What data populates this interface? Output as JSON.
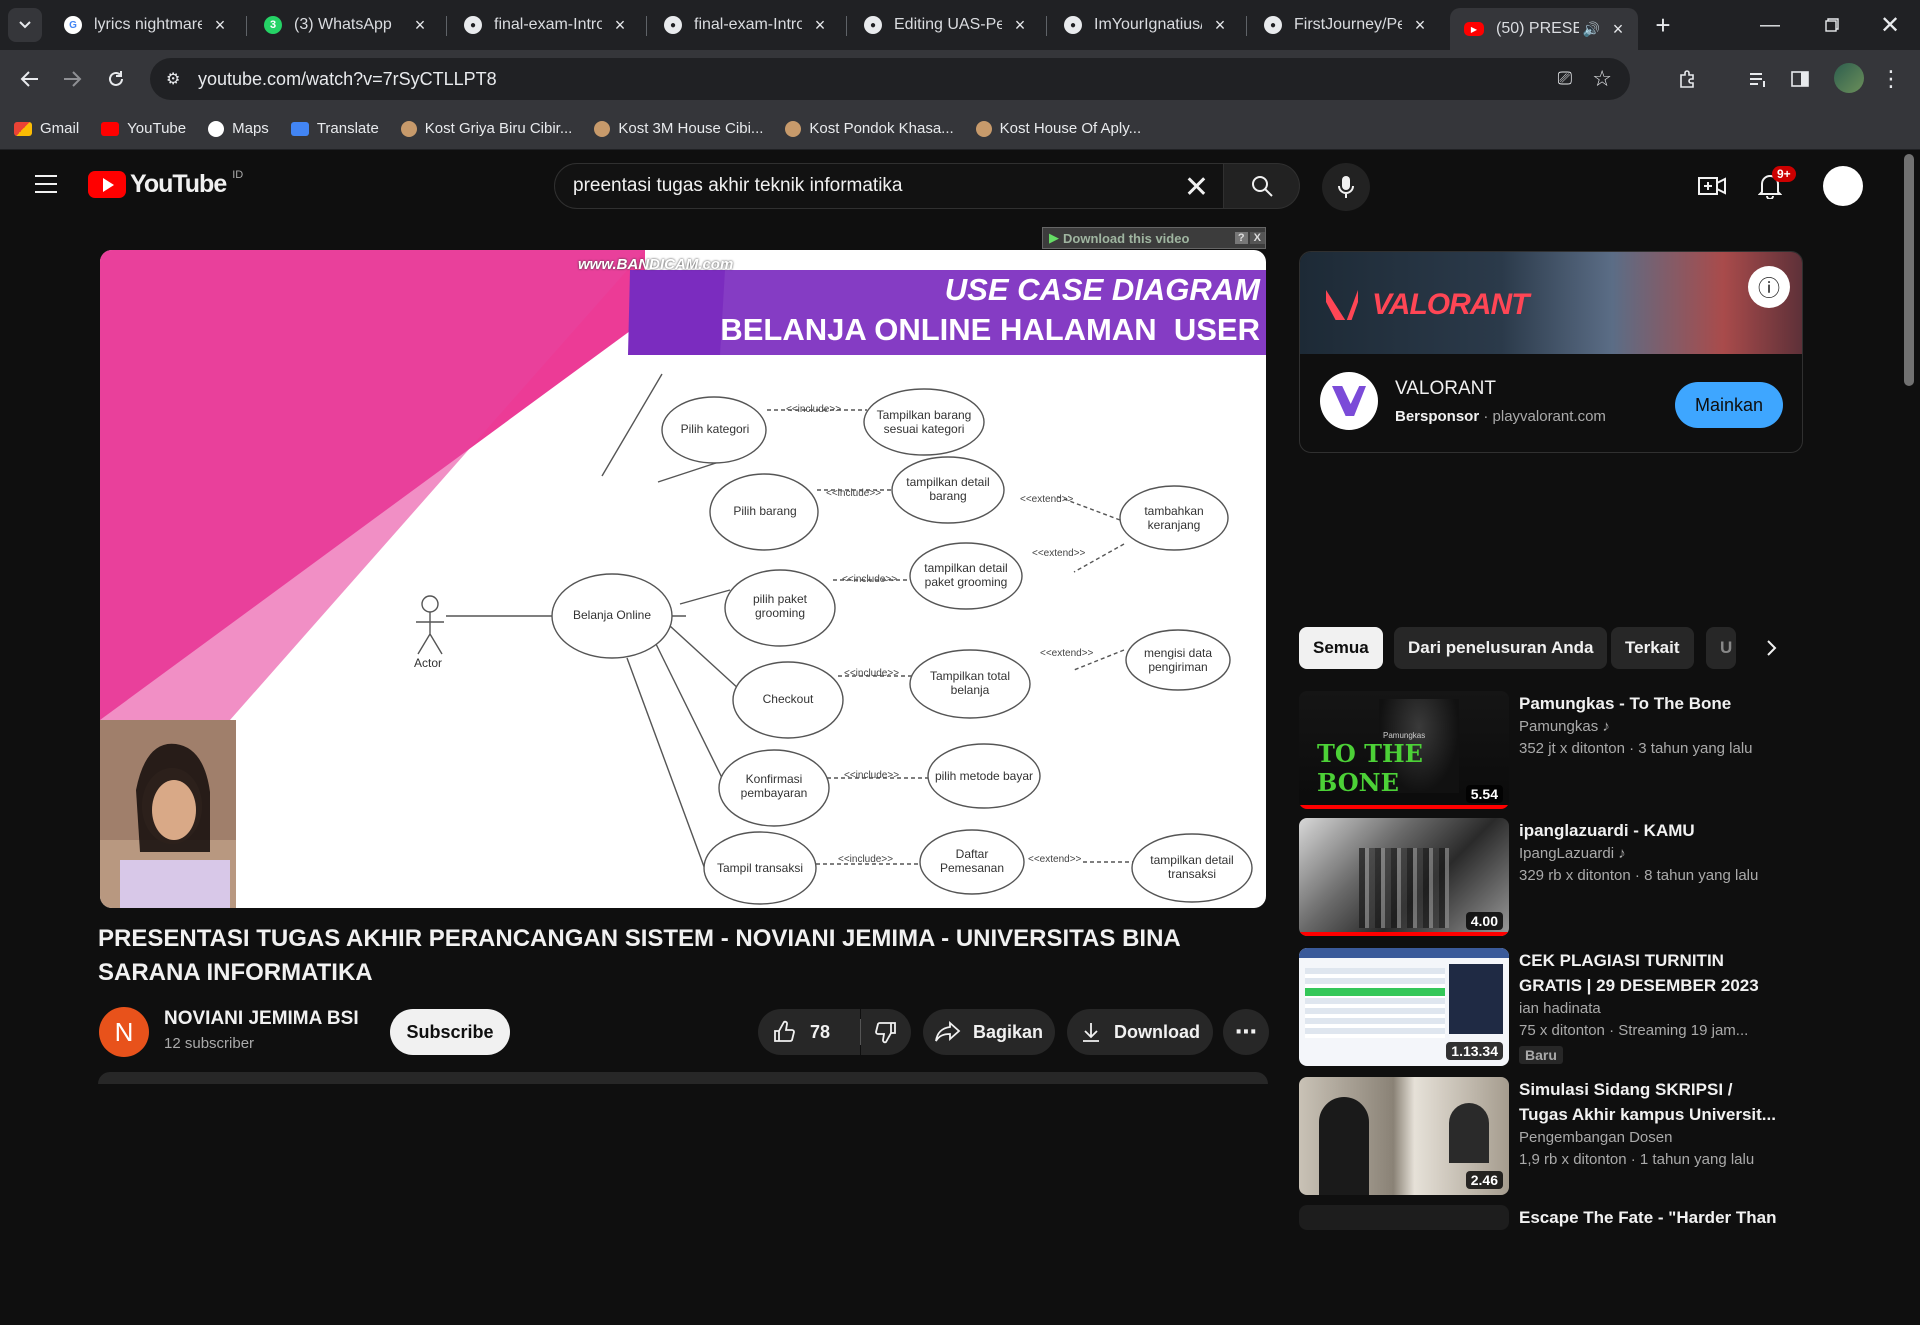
{
  "browser": {
    "tabs": [
      {
        "title": "lyrics nightmare",
        "active": false
      },
      {
        "title": "(3) WhatsApp",
        "active": false
      },
      {
        "title": "final-exam-Intro",
        "active": false
      },
      {
        "title": "final-exam-Intro",
        "active": false
      },
      {
        "title": "Editing UAS-Pen",
        "active": false
      },
      {
        "title": "ImYourIgnatius/",
        "active": false
      },
      {
        "title": "FirstJourney/Pen",
        "active": false
      },
      {
        "title": "(50) PRESEN",
        "active": true
      }
    ],
    "whatsapp_badge": "3",
    "url": "youtube.com/watch?v=7rSyCTLLPT8",
    "bookmarks": [
      "Gmail",
      "YouTube",
      "Maps",
      "Translate",
      "Kost Griya Biru Cibir...",
      "Kost 3M House Cibi...",
      "Kost Pondok Khasa...",
      "Kost House Of Aply..."
    ]
  },
  "youtube": {
    "logo_text": "YouTube",
    "region": "ID",
    "search_value": "preentasi tugas akhir teknik informatika",
    "notif_badge": "9+",
    "download_bar": "Download this video",
    "video": {
      "watermark": "www.BANDICAM.com",
      "slide_title_1": "USE CASE DIAGRAM",
      "slide_title_2": "BELANJA ONLINE HALAMAN  USER",
      "actor": "Actor",
      "main_case": "Belanja Online",
      "cases": [
        "Pilih kategori",
        "Pilih barang",
        "pilih paket grooming",
        "Checkout",
        "Konfirmasi pembayaran",
        "Tampil transaksi"
      ],
      "includes": [
        "Tampilkan barang sesuai kategori",
        "tampilkan detail barang",
        "tampilkan detail paket grooming",
        "Tampilkan total belanja",
        "pilih metode bayar",
        "Daftar Pemesanan"
      ],
      "extends": [
        "tambahkan keranjang",
        "mengisi data pengiriman",
        "tampilkan detail transaksi"
      ],
      "include_label": "<<include>>",
      "extend_label": "<<extend>>"
    },
    "title": "PRESENTASI TUGAS AKHIR PERANCANGAN SISTEM - NOVIANI JEMIMA - UNIVERSITAS BINA SARANA INFORMATIKA",
    "channel": {
      "avatar_letter": "N",
      "name": "NOVIANI JEMIMA BSI",
      "subs": "12 subscriber",
      "subscribe": "Subscribe"
    },
    "likes": "78",
    "share": "Bagikan",
    "download": "Download",
    "ad": {
      "brand_text": "VALORANT",
      "name": "VALORANT",
      "sponsor": "Bersponsor",
      "domain": "playvalorant.com",
      "cta": "Mainkan"
    },
    "chips": [
      "Semua",
      "Dari penelusuran Anda",
      "Terkait",
      "U"
    ],
    "recommendations": [
      {
        "title": "Pamungkas - To The Bone",
        "channel": "Pamungkas",
        "meta": "352 jt x ditonton",
        "age": "3 tahun yang lalu",
        "duration": "5.54",
        "thumb_text": "TO THE BONE",
        "thumb_small": "Pamungkas",
        "badge": ""
      },
      {
        "title": "ipanglazuardi - KAMU",
        "channel": "IpangLazuardi",
        "meta": "329 rb x ditonton",
        "age": "8 tahun yang lalu",
        "duration": "4.00",
        "thumb_text": "",
        "thumb_small": "",
        "badge": ""
      },
      {
        "title": "CEK PLAGIASI TURNITIN GRATIS | 29 DESEMBER 2023",
        "channel": "ian hadinata",
        "meta": "75 x ditonton",
        "age": "Streaming 19 jam...",
        "duration": "1.13.34",
        "thumb_text": "",
        "thumb_small": "",
        "badge": "Baru"
      },
      {
        "title": "Simulasi Sidang SKRIPSI / Tugas Akhir kampus Universit...",
        "channel": "Pengembangan Dosen",
        "meta": "1,9 rb x ditonton",
        "age": "1 tahun yang lalu",
        "duration": "2.46",
        "thumb_text": "",
        "thumb_small": "",
        "badge": ""
      },
      {
        "title": "Escape The Fate - \"Harder Than",
        "channel": "",
        "meta": "",
        "age": "",
        "duration": "",
        "thumb_text": "",
        "thumb_small": "",
        "badge": ""
      }
    ]
  },
  "colors": {
    "yt_red": "#ff0000",
    "blue_cta": "#3ea6ff",
    "slide_pink": "#ec3b96",
    "slide_purple": "#7b2cbf"
  }
}
